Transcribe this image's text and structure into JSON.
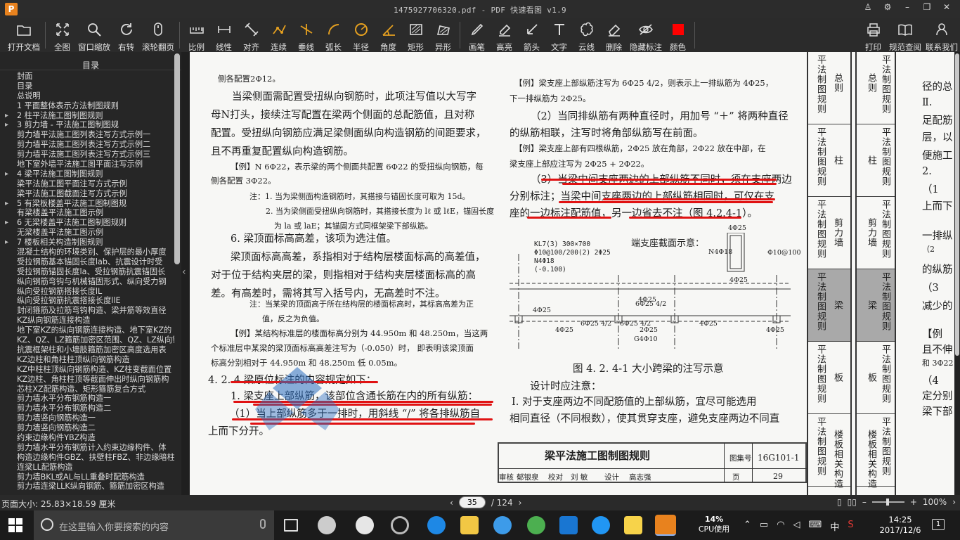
{
  "window": {
    "title": "1475927706320.pdf - PDF 快速看图 v1.9",
    "app_icon": "P"
  },
  "toolbar": [
    {
      "label": "打开文档",
      "icon": "folder-icon"
    },
    {
      "label": "全图",
      "icon": "fit-page-icon"
    },
    {
      "label": "窗口缩放",
      "icon": "zoom-icon"
    },
    {
      "label": "右转",
      "icon": "rotate-icon"
    },
    {
      "label": "滚轮翻页",
      "icon": "mouse-icon"
    },
    {
      "label": "比例",
      "icon": "scale-icon"
    },
    {
      "label": "线性",
      "icon": "linear-measure-icon"
    },
    {
      "label": "对齐",
      "icon": "align-measure-icon"
    },
    {
      "label": "连续",
      "icon": "continuous-measure-icon"
    },
    {
      "label": "垂线",
      "icon": "perpendicular-icon"
    },
    {
      "label": "弧长",
      "icon": "arc-length-icon"
    },
    {
      "label": "半径",
      "icon": "radius-icon"
    },
    {
      "label": "角度",
      "icon": "angle-icon"
    },
    {
      "label": "矩形",
      "icon": "rectangle-area-icon"
    },
    {
      "label": "异形",
      "icon": "polygon-area-icon"
    },
    {
      "label": "画笔",
      "icon": "pen-icon"
    },
    {
      "label": "高亮",
      "icon": "highlight-icon"
    },
    {
      "label": "箭头",
      "icon": "arrow-icon"
    },
    {
      "label": "文字",
      "icon": "text-icon"
    },
    {
      "label": "云线",
      "icon": "cloud-icon"
    },
    {
      "label": "删除",
      "icon": "eraser-icon"
    },
    {
      "label": "隐藏标注",
      "icon": "hide-markup-icon"
    },
    {
      "label": "颜色",
      "icon": "color-swatch-icon"
    },
    {
      "label": "打印",
      "icon": "printer-icon"
    },
    {
      "label": "规范查阅",
      "icon": "book-icon"
    },
    {
      "label": "联系我们",
      "icon": "contact-icon"
    }
  ],
  "colors": {
    "markup": "#ff0000",
    "underline": "#e01212",
    "watermark": "#2d6fc2"
  },
  "sidebar": {
    "title": "目录",
    "items": [
      {
        "t": "封面",
        "a": false
      },
      {
        "t": "目录",
        "a": false
      },
      {
        "t": "总说明",
        "a": false
      },
      {
        "t": "1 平面整体表示方法制图规则",
        "a": false
      },
      {
        "t": "2 柱平法施工图制图规则",
        "a": true
      },
      {
        "t": "3 剪力墙 - 平法施工图制图规",
        "a": true
      },
      {
        "t": "剪力墙平法施工图列表注写方式示例一",
        "a": false
      },
      {
        "t": "剪力墙平法施工图列表注写方式示例二",
        "a": false
      },
      {
        "t": "剪力墙平法施工图列表注写方式示例三",
        "a": false
      },
      {
        "t": "地下室外墙平法施工图平面注写示例",
        "a": false
      },
      {
        "t": "4 梁平法施工图制图规则",
        "a": true
      },
      {
        "t": "梁平法施工图平面注写方式示例",
        "a": false
      },
      {
        "t": "梁平法施工图截面注写方式示例",
        "a": false
      },
      {
        "t": "5 有梁板楼盖平法施工图制图规",
        "a": true
      },
      {
        "t": "有梁楼盖平法施工图示例",
        "a": false
      },
      {
        "t": "6 无梁楼盖平法施工图制图规则",
        "a": true
      },
      {
        "t": "无梁楼盖平法施工图示例",
        "a": false
      },
      {
        "t": "7 楼板相关构造制图规则",
        "a": true
      },
      {
        "t": "混凝土结构的环境类别、保护层的最小厚度",
        "a": false
      },
      {
        "t": "受拉钢筋基本锚固长度lab、抗震设计时受",
        "a": false
      },
      {
        "t": "受拉钢筋锚固长度la、受拉钢筋抗震锚固长",
        "a": false
      },
      {
        "t": "纵向钢筋弯钩与机械锚固形式、纵向受力钢",
        "a": false
      },
      {
        "t": "纵向受拉钢筋搭接长度lL",
        "a": false
      },
      {
        "t": "纵向受拉钢筋抗震搭接长度llE",
        "a": false
      },
      {
        "t": "封闭箍筋及拉筋弯钩构造、梁并筋等效直径",
        "a": false
      },
      {
        "t": "KZ纵向钢筋连接构造",
        "a": false
      },
      {
        "t": "地下室KZ的纵向钢筋连接构造、地下室KZ的",
        "a": false
      },
      {
        "t": "KZ、QZ、LZ箍筋加密区范围、QZ、LZ纵向钢",
        "a": false
      },
      {
        "t": "抗震框架柱和小墙肢箍筋加密区高度选用表",
        "a": false
      },
      {
        "t": "KZ边柱和角柱柱顶纵向钢筋构造",
        "a": false
      },
      {
        "t": "KZ中柱柱顶纵向钢筋构造、KZ柱变截面位置",
        "a": false
      },
      {
        "t": "KZ边柱、角柱柱顶等截面伸出时纵向钢筋构",
        "a": false
      },
      {
        "t": "芯柱XZ配筋构造、矩形箍筋复合方式",
        "a": false
      },
      {
        "t": "剪力墙水平分布钢筋构造一",
        "a": false
      },
      {
        "t": "剪力墙水平分布钢筋构造二",
        "a": false
      },
      {
        "t": "剪力墙竖向钢筋构造一",
        "a": false
      },
      {
        "t": "剪力墙竖向钢筋构造二",
        "a": false
      },
      {
        "t": "约束边缘构件YBZ构造",
        "a": false
      },
      {
        "t": "剪力墙水平分布钢筋计入约束边缘构件、体",
        "a": false
      },
      {
        "t": "构造边缘构件GBZ、扶壁柱FBZ、非边缘暗柱",
        "a": false
      },
      {
        "t": "连梁LL配筋构造",
        "a": false
      },
      {
        "t": "剪力墙BKL或AL与LL重叠时配筋构造",
        "a": false
      },
      {
        "t": "剪力墙连梁LLK纵向钢筋、箍筋加密区构造",
        "a": false
      }
    ]
  },
  "doc": {
    "left": [
      "侧各配置2Φ12。",
      "当梁侧面需配置受扭纵向钢筋时，此项注写值以大写字",
      "母N打头，接续注写配置在梁两个侧面的总配筋值，且对称",
      "配置。受扭纵向钢筋应满足梁侧面纵向构造钢筋的间距要求，",
      "且不再重复配置纵向构造钢筋。",
      "【例】N 6Φ22，表示梁的两个侧面共配置 6Φ22 的受扭纵向钢筋，每",
      "侧各配置 3Φ22。",
      "注：1. 当为梁侧面构造钢筋时，其搭接与锚固长度可取为 15d。",
      "2. 当为梁侧面受扭纵向钢筋时，其搭接长度为 lℓ 或 lℓE，锚固长度",
      "为 la 或 laE；其锚固方式同框架梁下部纵筋。",
      "6. 梁顶面标高高差，该项为选注值。",
      "梁顶面标高高差，系指相对于结构层楼面标高的高差值，",
      "对于位于结构夹层的梁，则指相对于结构夹层楼面标高的高",
      "差。有高差时，需将其写入括号内，无高差时不注。",
      "注：当某梁的顶面高于所在结构层的楼面标高时，其标高高差为正",
      "值，反之为负值。",
      "【例】某结构标准层的楼面标高分别为 44.950m 和 48.250m，当这两",
      "个标准层中某梁的梁顶面标高高差注写为（-0.050）时，  即表明该梁顶面",
      "标高分别相对于 44.950m 和 48.250m 低 0.05m。",
      "4. 2. 4  梁原位标注的内容规定如下：",
      "1. 梁支座上部纵筋，该部位含通长筋在内的所有纵筋：",
      "（1）当上部纵筋多于一排时，用斜线 “/” 将各排纵筋自",
      "上而下分开。"
    ],
    "right": [
      "【例】梁支座上部纵筋注写为 6Φ25 4/2，则表示上一排纵筋为 4Φ25，",
      "下一排纵筋为 2Φ25。",
      "（2）当同排纵筋有两种直径时，用加号 “＋” 将两种直径",
      "的纵筋相联，注写时将角部纵筋写在前面。",
      "【例】梁支座上部有四根纵筋，2Φ25 放在角部，2Φ22 放在中部，在",
      "梁支座上部应注写为 2Φ25 + 2Φ22。",
      "（3）当梁中间支座两边的上部纵筋不同时，须在支座两边",
      "分别标注；当梁中间支座两边的上部纵筋相同时，可仅在支",
      "座的一边标注配筋值，另一边省去不注（图 4.2.4-1）。",
      "图 4. 2. 4-1  大小跨梁的注写示意",
      "设计时应注意：",
      "Ⅰ. 对于支座两边不同配筋值的上部纵筋，宜尽可能选用",
      "相同直径（不同根数），使其贯穿支座，避免支座两边不同直"
    ],
    "figure": {
      "end_label": "端支座截面示意：",
      "beam": [
        "KL7(3)  300×700",
        "Φ10@100/200(2) 2Φ25",
        "N4Φ18",
        "(-0.100)"
      ],
      "labels": [
        "4Φ25",
        "6Φ25  4/2",
        "4Φ25",
        "6Φ25  4/2",
        "4Φ25",
        "4Φ25",
        "6Φ25  4/2",
        "4Φ25",
        "2Φ25",
        "G4Φ10",
        "N4Φ18",
        "Φ10@100",
        "4Φ25",
        "4Φ25"
      ]
    },
    "titleblock": {
      "title": "梁平法施工图制图规则",
      "atlas_label": "图集号",
      "atlas_no": "16G101-1",
      "row": [
        "审核",
        "郁银泉",
        "校对",
        "刘  敏",
        "设计",
        "高志强"
      ],
      "page_label": "页",
      "page_no": "29"
    },
    "tabs1": [
      {
        "a": "平法制图规则",
        "b": "总则"
      },
      {
        "a": "平法制图规则",
        "b": "柱"
      },
      {
        "a": "平法制图规则",
        "b": "剪力墙"
      },
      {
        "a": "平法制图规则",
        "b": "梁"
      },
      {
        "a": "平法制图规则",
        "b": "板"
      },
      {
        "a": "平法制图规则",
        "b": "楼板相关构造"
      }
    ],
    "far_right": [
      "径的总",
      "Ⅱ.",
      "足配筋",
      "层，以",
      "便施工",
      "2.",
      "（1",
      "上而下",
      "一排纵",
      "（2",
      "的纵筋",
      "（3",
      "减少的",
      "【例",
      "且不伸",
      "和 3Φ22",
      "（4",
      "定分别",
      "梁下部"
    ]
  },
  "status": {
    "page_size": "页面大小: 25.83×18.59 厘米",
    "page_current": "35",
    "page_total": "/ 124",
    "zoom": "100%"
  },
  "taskbar": {
    "search_placeholder": "在这里输入你要搜索的内容",
    "cpu_value": "14%",
    "cpu_label": "CPU使用",
    "ime": "中",
    "time": "14:25",
    "date": "2017/12/6",
    "notifications": "1"
  }
}
